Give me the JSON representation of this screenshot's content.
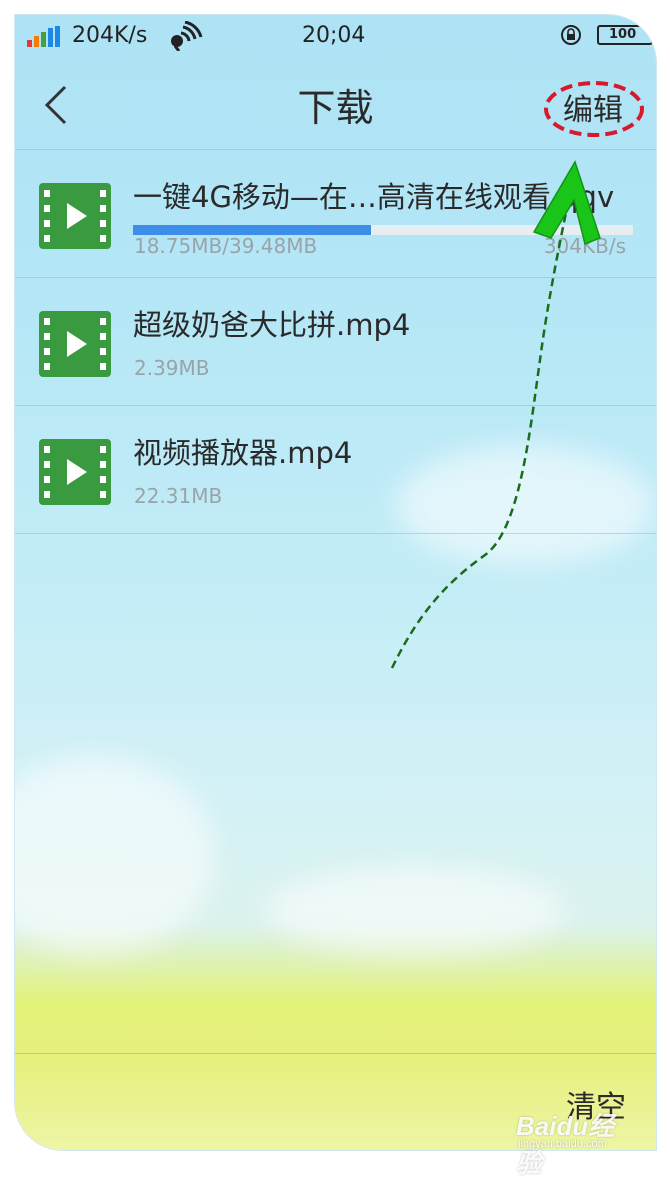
{
  "status_bar": {
    "net_speed": "204K/s",
    "time": "20;04",
    "battery": "100"
  },
  "nav": {
    "title": "下载",
    "edit_label": "编辑"
  },
  "downloads": [
    {
      "name": "一键4G移动—在…高清在线观看.qqv",
      "size": "18.75MB/39.48MB",
      "speed": "304KB/s",
      "progress": 0.475
    },
    {
      "name": "超级奶爸大比拼.mp4",
      "size": "2.39MB"
    },
    {
      "name": "视频播放器.mp4",
      "size": "22.31MB"
    }
  ],
  "bottom": {
    "clear_label": "清空"
  },
  "watermark": {
    "brand": "Baidu经验",
    "url": "jingyan.baidu.com"
  },
  "colors": {
    "icon_green": "#3a9a3f",
    "progress_blue": "#3d8ee9",
    "annotation_red": "#d7192e",
    "annotation_arrow": "#19c519"
  },
  "icons": [
    "signal-icon",
    "wifi-icon",
    "rotation-lock-icon",
    "battery-icon",
    "back-icon",
    "video-file-icon"
  ]
}
